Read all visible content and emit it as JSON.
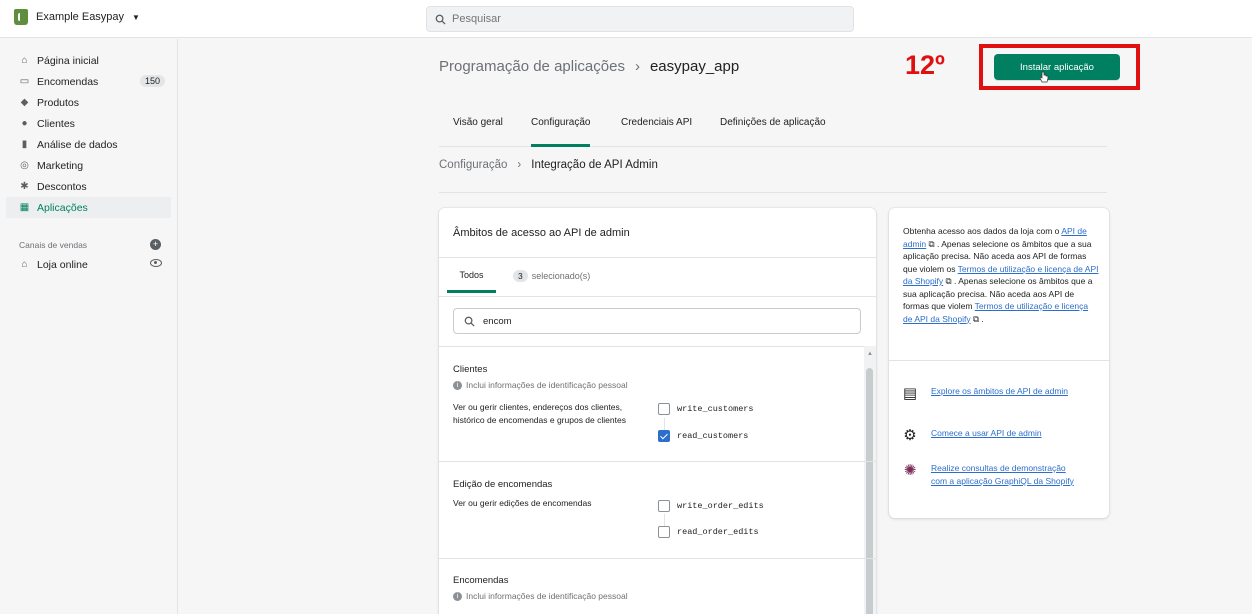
{
  "topbar": {
    "store_name": "Example Easypay",
    "search_placeholder": "Pesquisar"
  },
  "sidebar": {
    "items": [
      {
        "label": "Página inicial",
        "icon": "home-icon"
      },
      {
        "label": "Encomendas",
        "icon": "orders-icon",
        "badge": "150"
      },
      {
        "label": "Produtos",
        "icon": "tag-icon"
      },
      {
        "label": "Clientes",
        "icon": "person-icon"
      },
      {
        "label": "Análise de dados",
        "icon": "bar-chart-icon"
      },
      {
        "label": "Marketing",
        "icon": "target-icon"
      },
      {
        "label": "Descontos",
        "icon": "discount-icon"
      },
      {
        "label": "Aplicações",
        "icon": "apps-icon"
      }
    ],
    "sales_channels_title": "Canais de vendas",
    "online_store": "Loja online"
  },
  "header": {
    "breadcrumb_parent": "Programação de aplicações",
    "breadcrumb_current": "easypay_app",
    "step_label": "12º",
    "install_label": "Instalar aplicação"
  },
  "tabs": [
    "Visão geral",
    "Configuração",
    "Credenciais API",
    "Definições de aplicação"
  ],
  "sub_breadcrumb": {
    "parent": "Configuração",
    "current": "Integração de API Admin"
  },
  "scopes_card": {
    "title": "Âmbitos de acesso ao API de admin",
    "tab_all": "Todos",
    "selected_count": "3",
    "selected_label": "selecionado(s)",
    "filter_value": "encom",
    "groups": [
      {
        "title": "Clientes",
        "info": "Inclui informações de identificação pessoal",
        "description": "Ver ou gerir clientes, endereços dos clientes, histórico de encomendas e grupos de clientes",
        "scopes": [
          {
            "name": "write_customers",
            "checked": false
          },
          {
            "name": "read_customers",
            "checked": true
          }
        ]
      },
      {
        "title": "Edição de encomendas",
        "description": "Ver ou gerir edições de encomendas",
        "scopes": [
          {
            "name": "write_order_edits",
            "checked": false
          },
          {
            "name": "read_order_edits",
            "checked": false
          }
        ]
      },
      {
        "title": "Encomendas",
        "info": "Inclui informações de identificação pessoal"
      }
    ]
  },
  "help_card": {
    "text_1": "Obtenha acesso aos dados da loja com o",
    "link_1": "API de admin",
    "text_2": ". Apenas selecione os âmbitos que a sua aplicação precisa. Não aceda aos API de formas que violem os",
    "link_2": "Termos de utilização e licença de API da Shopify",
    "text_3": ". Apenas selecione os âmbitos que a sua aplicação precisa. Não aceda aos API de formas que violem",
    "link_3": "Termos de utilização e licença de API da Shopify",
    "text_4": ".",
    "resources": [
      {
        "icon": "document-icon",
        "label": "Explore os âmbitos de API de admin"
      },
      {
        "icon": "gear-cluster-icon",
        "label": "Comece a usar API de admin"
      },
      {
        "icon": "graphql-icon",
        "label": "Realize consultas de demonstração com a aplicação GraphiQL da Shopify"
      }
    ]
  },
  "colors": {
    "accent": "#008060",
    "highlight": "#e01010",
    "link": "#2c6ecb"
  }
}
